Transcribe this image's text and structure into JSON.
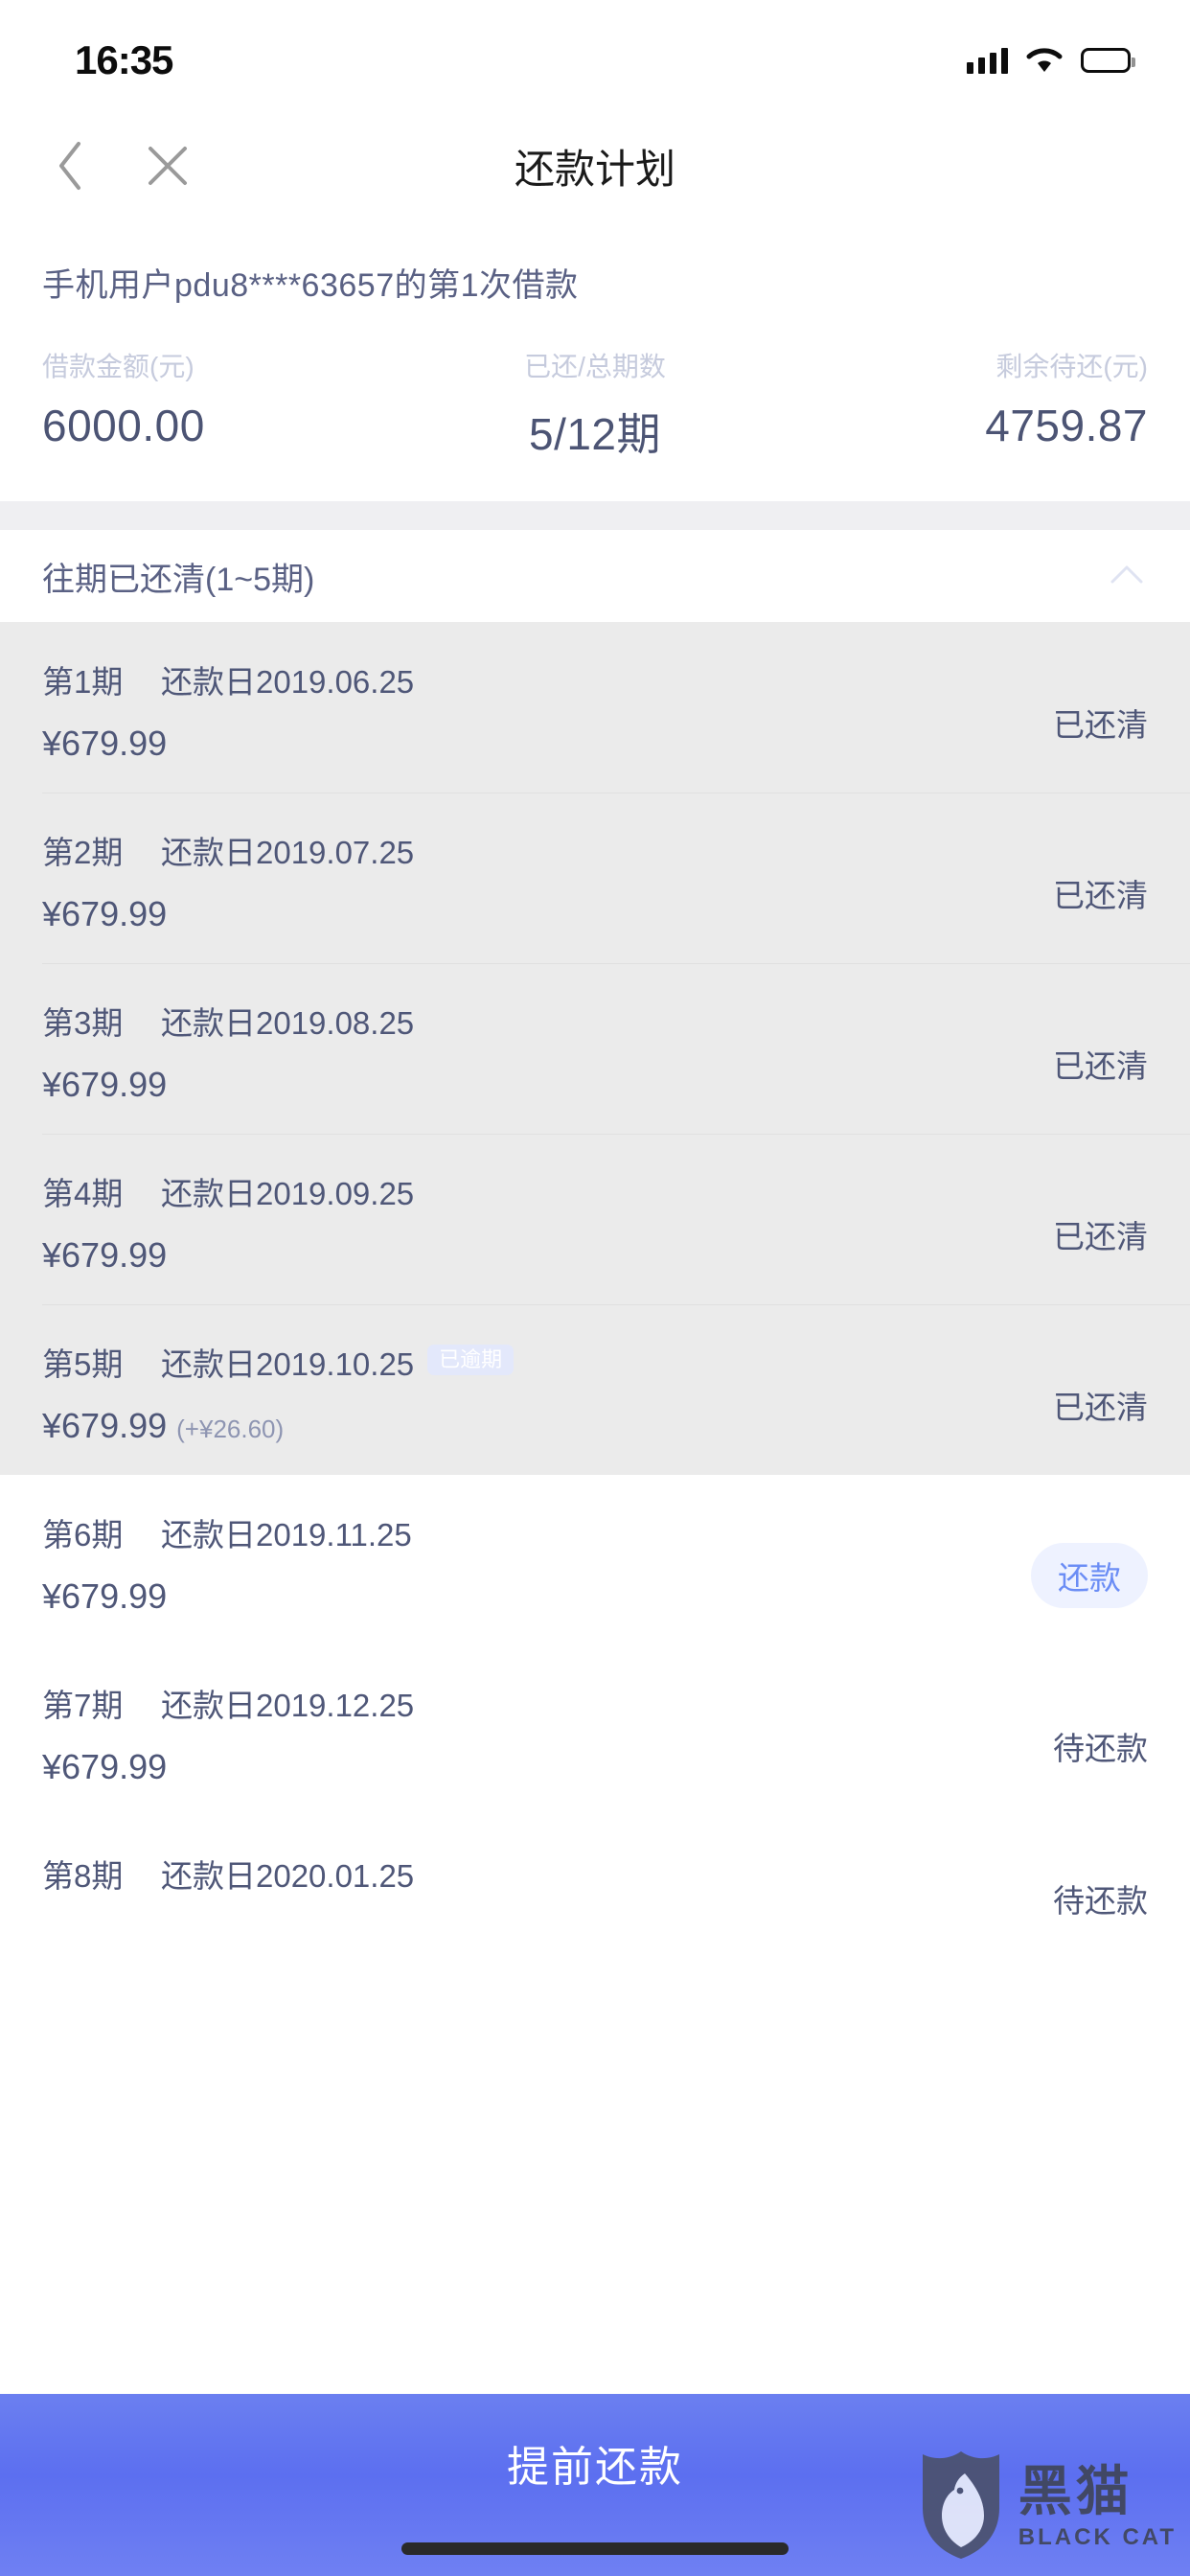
{
  "statusbar": {
    "time": "16:35",
    "signal_icon": "signal-bars-icon",
    "wifi_icon": "wifi-icon",
    "battery_icon": "battery-icon"
  },
  "header": {
    "title": "还款计划",
    "back_icon": "chevron-left-icon",
    "close_icon": "close-icon"
  },
  "summary": {
    "user_line": "手机用户pdu8****63657的第1次借款",
    "stats": [
      {
        "label": "借款金额(元)",
        "value": "6000.00"
      },
      {
        "label": "已还/总期数",
        "value": "5/12期"
      },
      {
        "label": "剩余待还(元)",
        "value": "4759.87"
      }
    ]
  },
  "section": {
    "title": "往期已还清(1~5期)",
    "collapse_icon": "chevron-up-icon"
  },
  "paid_rows": [
    {
      "period": "第1期",
      "date_label": "还款日2019.06.25",
      "amount": "¥679.99",
      "extra": "",
      "badge": "",
      "status": "已还清"
    },
    {
      "period": "第2期",
      "date_label": "还款日2019.07.25",
      "amount": "¥679.99",
      "extra": "",
      "badge": "",
      "status": "已还清"
    },
    {
      "period": "第3期",
      "date_label": "还款日2019.08.25",
      "amount": "¥679.99",
      "extra": "",
      "badge": "",
      "status": "已还清"
    },
    {
      "period": "第4期",
      "date_label": "还款日2019.09.25",
      "amount": "¥679.99",
      "extra": "",
      "badge": "",
      "status": "已还清"
    },
    {
      "period": "第5期",
      "date_label": "还款日2019.10.25",
      "amount": "¥679.99",
      "extra": "(+¥26.60)",
      "badge": "已逾期",
      "status": "已还清"
    }
  ],
  "due_rows": [
    {
      "period": "第6期",
      "date_label": "还款日2019.11.25",
      "amount": "¥679.99",
      "extra": "",
      "badge": "",
      "status": "",
      "action": "还款"
    },
    {
      "period": "第7期",
      "date_label": "还款日2019.12.25",
      "amount": "¥679.99",
      "extra": "",
      "badge": "",
      "status": "待还款",
      "action": ""
    },
    {
      "period": "第8期",
      "date_label": "还款日2020.01.25",
      "amount": "",
      "extra": "",
      "badge": "",
      "status": "待还款",
      "action": ""
    }
  ],
  "bottom": {
    "cta_label": "提前还款",
    "accent_color": "#5c6ff0"
  },
  "watermark": {
    "cn": "黑猫",
    "en": "BLACK CAT",
    "logo_icon": "black-cat-shield-icon"
  }
}
